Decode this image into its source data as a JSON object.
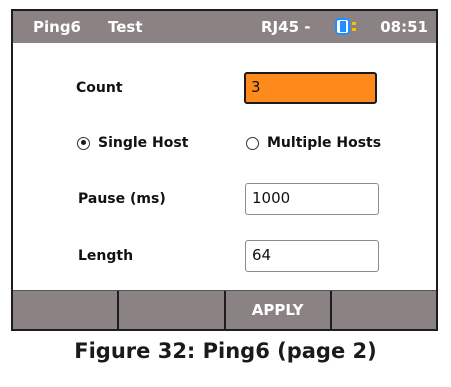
{
  "header": {
    "app": "Ping6",
    "mode": "Test",
    "port": "RJ45 -",
    "time": "08:51"
  },
  "form": {
    "count_label": "Count",
    "count_value": "3",
    "single_host_label": "Single Host",
    "multiple_hosts_label": "Multiple Hosts",
    "selected_host_mode": "Single Host",
    "pause_label": "Pause (ms)",
    "pause_value": "1000",
    "length_label": "Length",
    "length_value": "64"
  },
  "softkeys": [
    "",
    "",
    "APPLY",
    ""
  ],
  "caption": "Figure 32: Ping6 (page 2)",
  "colors": {
    "header_bg": "#8b8383",
    "active_field": "#ff8a1c",
    "battery_blue": "#1e90ff",
    "battery_yellow": "#f5c400"
  }
}
